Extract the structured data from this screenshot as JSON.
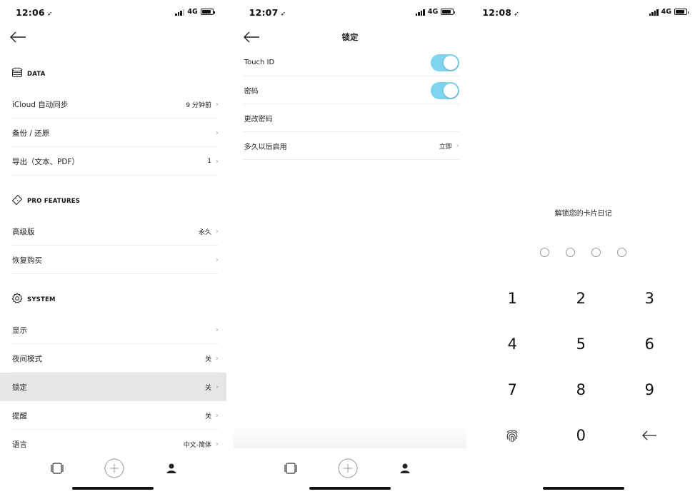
{
  "screen1": {
    "status": {
      "time": "12:06",
      "network": "4G"
    },
    "sections": {
      "data": {
        "title": "DATA",
        "rows": [
          {
            "label": "iCloud 自动同步",
            "value": "9 分钟前"
          },
          {
            "label": "备份 / 还原",
            "value": ""
          },
          {
            "label": "导出（文本、PDF）",
            "value": "1"
          }
        ]
      },
      "pro": {
        "title": "PRO FEATURES",
        "rows": [
          {
            "label": "高级版",
            "value": "永久"
          },
          {
            "label": "恢复购买",
            "value": ""
          }
        ]
      },
      "system": {
        "title": "SYSTEM",
        "rows": [
          {
            "label": "显示",
            "value": ""
          },
          {
            "label": "夜间模式",
            "value": "关"
          },
          {
            "label": "锁定",
            "value": "关"
          },
          {
            "label": "提醒",
            "value": "关"
          },
          {
            "label": "语言",
            "value": "中文-简体"
          }
        ]
      }
    },
    "chevron": "›",
    "tabbar": {
      "icons": [
        "cards-icon",
        "add-icon",
        "profile-icon"
      ],
      "active": "profile-icon"
    }
  },
  "screen2": {
    "status": {
      "time": "12:07",
      "network": "4G"
    },
    "title": "锁定",
    "rows": [
      {
        "label": "Touch ID",
        "toggle": true
      },
      {
        "label": "密码",
        "toggle": true
      },
      {
        "label": "更改密码",
        "value": ""
      },
      {
        "label": "多久以后启用",
        "value": "立即"
      }
    ],
    "toggle_color": "#7fd3ee",
    "chevron": "›"
  },
  "screen3": {
    "status": {
      "time": "12:08",
      "network": "4G"
    },
    "prompt": "解锁您的卡片日记",
    "pin_length": 4,
    "keys": [
      "1",
      "2",
      "3",
      "4",
      "5",
      "6",
      "7",
      "8",
      "9",
      "fingerprint-icon",
      "0",
      "back-arrow-icon"
    ]
  }
}
